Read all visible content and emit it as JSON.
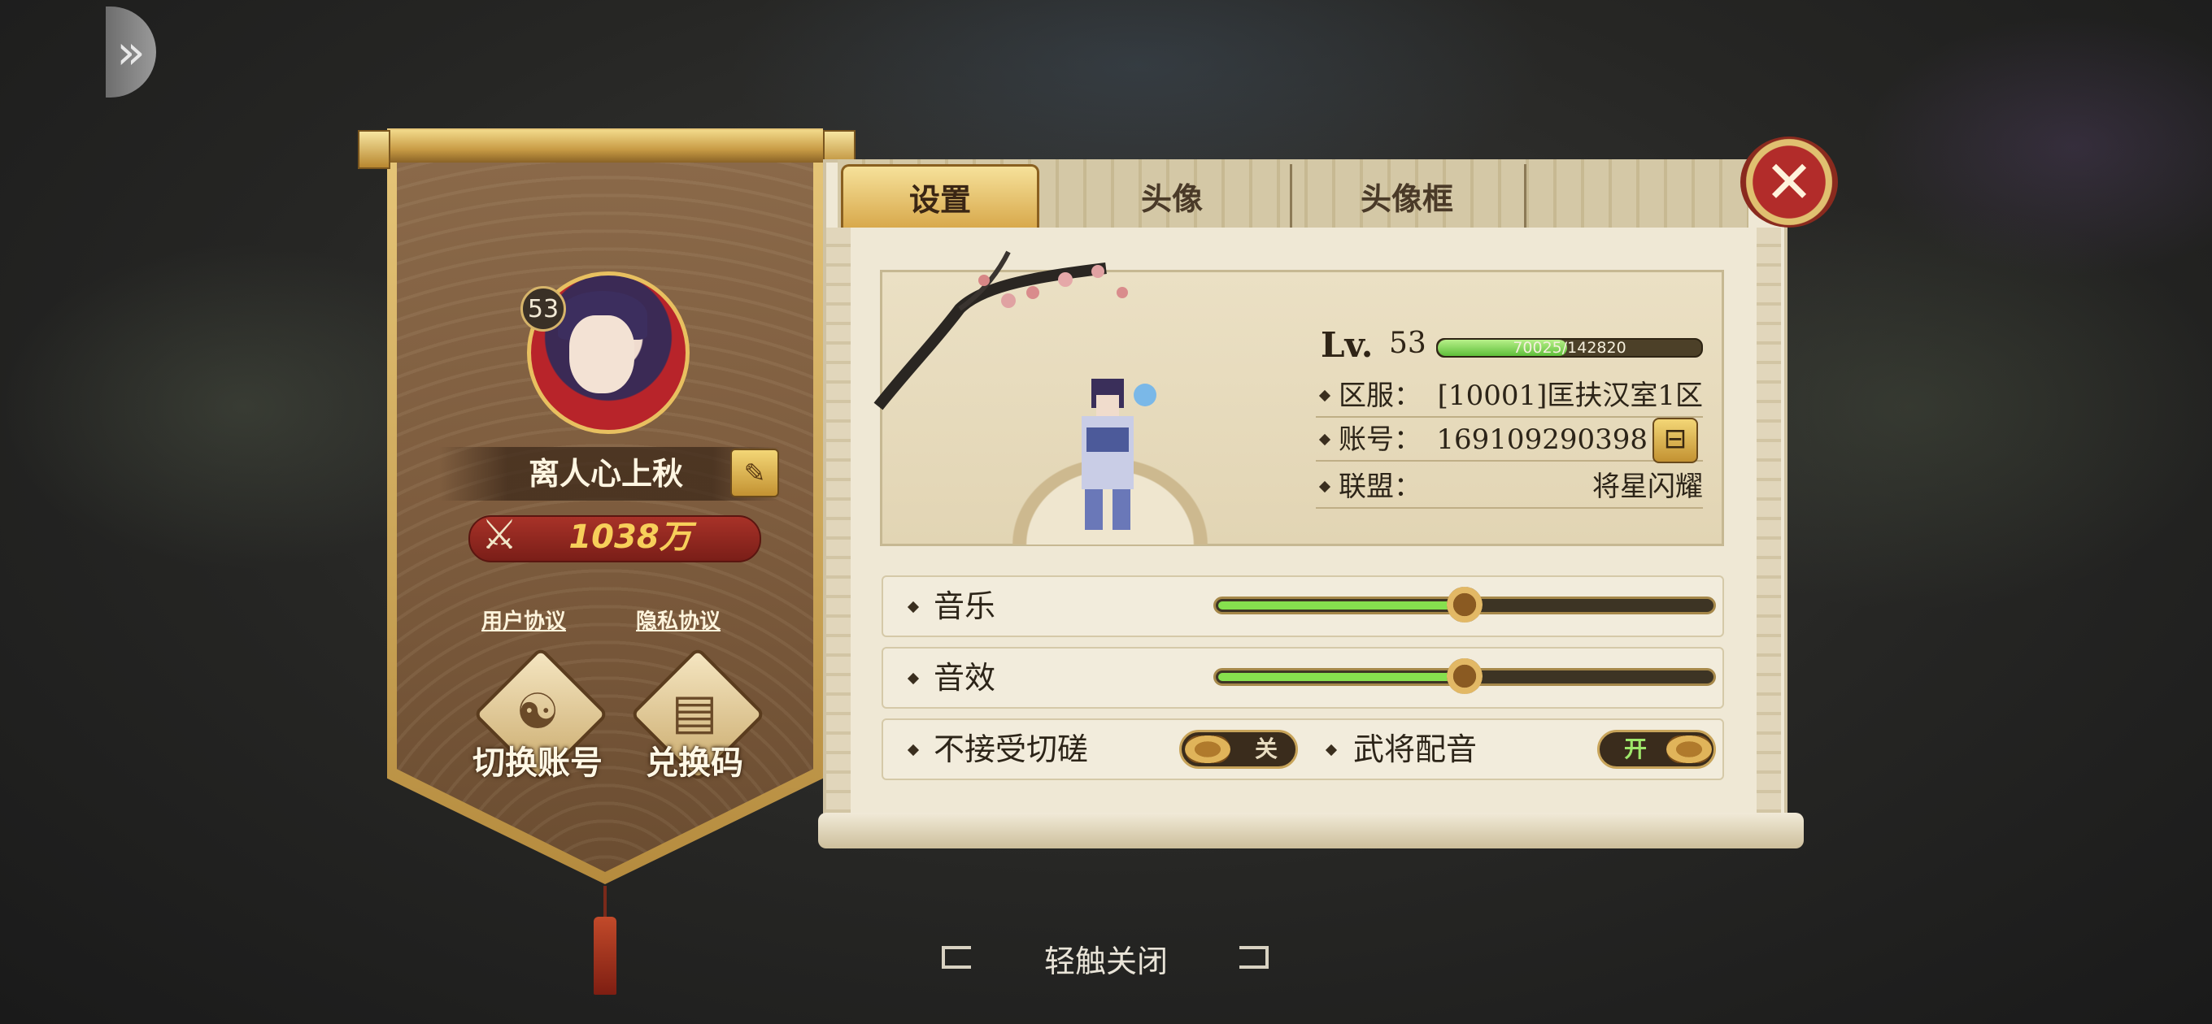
{
  "player": {
    "level_badge": "53",
    "name": "离人心上秋",
    "power": "1038万"
  },
  "links": {
    "user_agreement": "用户协议",
    "privacy_policy": "隐私协议"
  },
  "actions": {
    "switch_account": "切换账号",
    "redeem_code": "兑换码"
  },
  "tabs": [
    {
      "label": "设置",
      "active": true
    },
    {
      "label": "头像",
      "active": false
    },
    {
      "label": "头像框",
      "active": false
    }
  ],
  "profile": {
    "lv_label": "Lv.",
    "level": "53",
    "exp_text": "70025/142820",
    "exp_fraction": 0.49,
    "server_label": "区服：",
    "server_value": "[10001]匡扶汉室1区",
    "account_label": "账号：",
    "account_value": "169109290398",
    "alliance_label": "联盟：",
    "alliance_value": "将星闪耀"
  },
  "settings": {
    "music_label": "音乐",
    "music_level": 0.5,
    "sfx_label": "音效",
    "sfx_level": 0.5,
    "no_duel_label": "不接受切磋",
    "no_duel_state": "关",
    "voice_label": "武将配音",
    "voice_state": "开"
  },
  "footer": {
    "tap_close": "轻触关闭"
  },
  "icons": {
    "expand": "chevron-right-icon",
    "close": "close-icon",
    "edit": "brush-icon",
    "power": "crossed-swords-icon",
    "copy": "copy-icon",
    "switch_account": "swirl-icon",
    "redeem": "scroll-icon"
  },
  "colors": {
    "slider_fill": "#86e04e",
    "banner": "#7c5b3d",
    "panel": "#efe8d5",
    "accent_gold": "#d8a94c",
    "close_red": "#b22c2a",
    "power_text": "#f7cf5a"
  }
}
